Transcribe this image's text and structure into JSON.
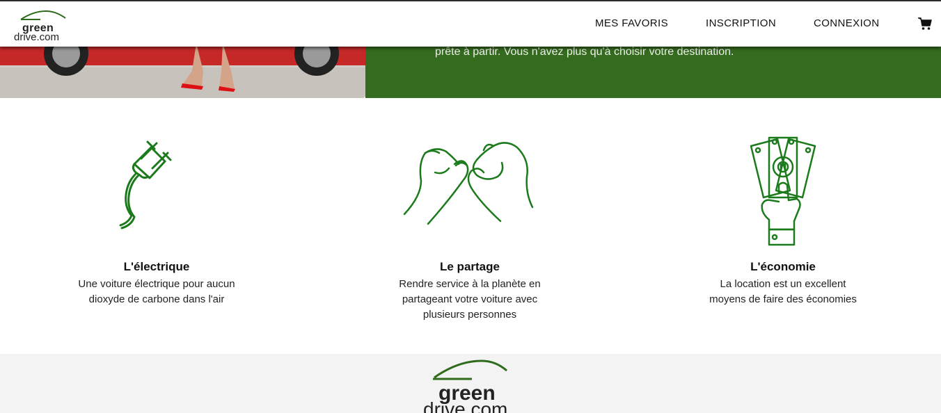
{
  "header": {
    "logo_line1": "green",
    "logo_line2": "drive.com",
    "nav": [
      {
        "label": "MES FAVORIS"
      },
      {
        "label": "INSCRIPTION"
      },
      {
        "label": "CONNEXION"
      }
    ],
    "cart_icon": "shopping-cart-icon"
  },
  "hero": {
    "text": "prête à partir. Vous n'avez plus qu'à choisir votre destination.",
    "accent_color": "#356b1f"
  },
  "features": [
    {
      "icon": "electric-plug-icon",
      "title": "L'électrique",
      "line1": "Une voiture électrique pour aucun",
      "line2": "dioxyde de carbone dans l'air",
      "line3": ""
    },
    {
      "icon": "pinky-promise-hands-icon",
      "title": "Le partage",
      "line1": "Rendre service à la planète en",
      "line2": "partageant votre voiture avec",
      "line3": "plusieurs personnes"
    },
    {
      "icon": "money-hand-icon",
      "title": "L'économie",
      "line1": "La location est un excellent",
      "line2": "moyens de faire des économies",
      "line3": ""
    }
  ],
  "footer": {
    "logo_line1": "green",
    "logo_line2": "drive.com"
  },
  "colors": {
    "brand_green": "#356b1f",
    "icon_green": "#1b7a1b"
  }
}
